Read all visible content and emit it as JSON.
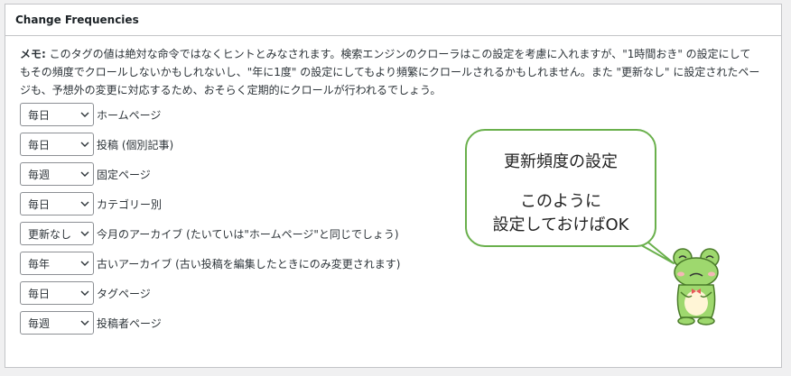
{
  "panel": {
    "title": "Change Frequencies"
  },
  "note": {
    "label": "メモ:",
    "text": " このタグの値は絶対な命令ではなくヒントとみなされます。検索エンジンのクローラはこの設定を考慮に入れますが、\"1時間おき\" の設定にしてもその頻度でクロールしないかもしれないし、\"年に1度\" の設定にしてもより頻繁にクロールされるかもしれません。また \"更新なし\" に設定されたページも、予想外の変更に対応するため、おそらく定期的にクロールが行われるでしょう。"
  },
  "rows": [
    {
      "value": "毎日",
      "label": "ホームページ"
    },
    {
      "value": "毎日",
      "label": "投稿 (個別記事)"
    },
    {
      "value": "毎週",
      "label": "固定ページ"
    },
    {
      "value": "毎日",
      "label": "カテゴリー別"
    },
    {
      "value": "更新なし",
      "label": "今月のアーカイブ (たいていは\"ホームページ\"と同じでしょう)"
    },
    {
      "value": "毎年",
      "label": "古いアーカイブ (古い投稿を編集したときにのみ変更されます)"
    },
    {
      "value": "毎日",
      "label": "タグページ"
    },
    {
      "value": "毎週",
      "label": "投稿者ページ"
    }
  ],
  "bubble": {
    "line1": "更新頻度の設定",
    "line2": "このように",
    "line3": "設定しておけばOK"
  },
  "colors": {
    "bubble_border": "#6ab04c",
    "frog_body": "#9ed86e",
    "panel_border": "#c3c4c7"
  },
  "icons": {
    "select_arrow": "chevron-down-icon",
    "mascot": "frog-illustration"
  }
}
